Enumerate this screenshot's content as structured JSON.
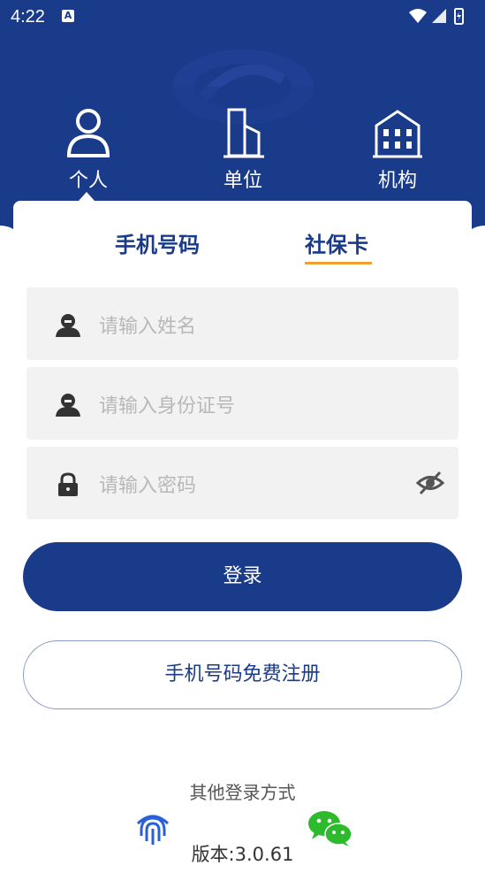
{
  "status_bar": {
    "time": "4:22",
    "badge": "A"
  },
  "roles": [
    {
      "label": "个人",
      "icon": "person-icon"
    },
    {
      "label": "单位",
      "icon": "building-icon"
    },
    {
      "label": "机构",
      "icon": "institution-icon"
    }
  ],
  "login_tabs": {
    "phone": "手机号码",
    "social_card": "社保卡"
  },
  "fields": {
    "name_placeholder": "请输入姓名",
    "id_placeholder": "请输入身份证号",
    "password_placeholder": "请输入密码"
  },
  "buttons": {
    "login": "登录",
    "register": "手机号码免费注册"
  },
  "other_login": {
    "title": "其他登录方式"
  },
  "version": "版本:3.0.61",
  "colors": {
    "primary": "#1a3a8a",
    "accent_underline": "#f0a030",
    "field_bg": "#f2f2f2",
    "wechat": "#2dbb2d"
  }
}
